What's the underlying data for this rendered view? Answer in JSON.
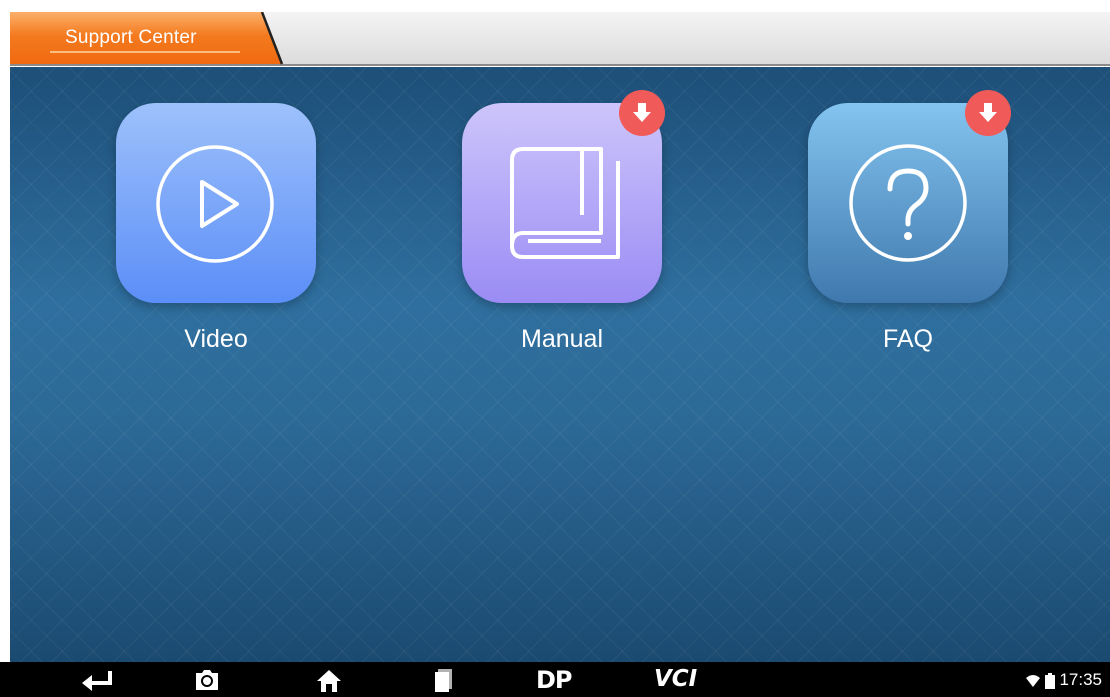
{
  "header": {
    "tab_label": "Support Center"
  },
  "tiles": [
    {
      "label": "Video",
      "icon": "play-circle-icon"
    },
    {
      "label": "Manual",
      "icon": "book-icon",
      "download_badge": true
    },
    {
      "label": "FAQ",
      "icon": "question-circle-icon",
      "download_badge": true
    }
  ],
  "navbar": {
    "buttons": [
      "back-icon",
      "camera-icon",
      "home-icon",
      "recent-apps-icon",
      "dp-icon",
      "vci-icon"
    ],
    "dp_label": "DP",
    "vci_label": "VCI"
  },
  "status_bar": {
    "time": "17:35",
    "icons": [
      "wifi-icon",
      "battery-icon"
    ]
  },
  "colors": {
    "tab_orange": "#f47a1f",
    "badge_red": "#f05a58",
    "background_blue": "#2c6996"
  }
}
